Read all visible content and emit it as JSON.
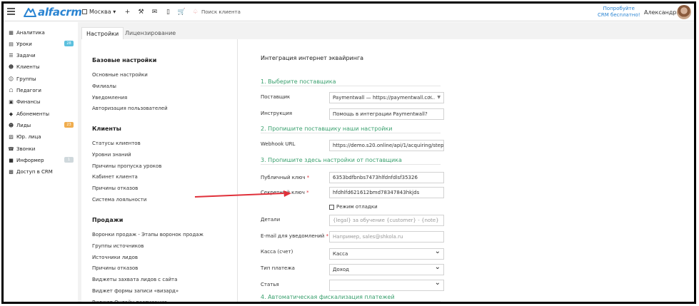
{
  "topbar": {
    "logo_text": "alfacrm",
    "city": "Москва",
    "search_placeholder": "Поиск клиента",
    "promo_line1": "Попробуйте",
    "promo_line2": "CRM бесплатно!",
    "user_name": "Александра"
  },
  "sidebar": {
    "items": [
      {
        "label": "Аналитика",
        "icon": "analytics-icon"
      },
      {
        "label": "Уроки",
        "icon": "calendar-icon",
        "badge": "28",
        "badge_color": "#5bc0de"
      },
      {
        "label": "Задачи",
        "icon": "tasks-icon"
      },
      {
        "label": "Клиенты",
        "icon": "user-icon"
      },
      {
        "label": "Группы",
        "icon": "users-icon"
      },
      {
        "label": "Педагоги",
        "icon": "graduation-icon"
      },
      {
        "label": "Финансы",
        "icon": "money-icon"
      },
      {
        "label": "Абонементы",
        "icon": "tag-icon"
      },
      {
        "label": "Лиды",
        "icon": "user-plus-icon",
        "badge": "23",
        "badge_color": "#f0ad4e"
      },
      {
        "label": "Юр. лица",
        "icon": "building-icon"
      },
      {
        "label": "Звонки",
        "icon": "phone-icon"
      },
      {
        "label": "Информер",
        "icon": "informer-icon",
        "badge": "1",
        "badge_color": "#cfd8dc"
      },
      {
        "label": "Доступ в CRM",
        "icon": "lock-icon"
      }
    ]
  },
  "tabs": [
    "Настройки",
    "Лицензирование"
  ],
  "settings": {
    "groups": [
      {
        "title": "Базовые настройки",
        "links": [
          "Основные настройки",
          "Филиалы",
          "Уведомления",
          "Авторизация пользователей"
        ]
      },
      {
        "title": "Клиенты",
        "links": [
          "Статусы клиентов",
          "Уровни знаний",
          "Причины пропуска уроков",
          "Кабинет клиента",
          "Причины отказов",
          "Система лояльности"
        ]
      },
      {
        "title": "Продажи",
        "links": [
          "Воронки продаж - Этапы воронок продаж",
          "Группы источников",
          "Источники лидов",
          "Причины отказов",
          "Виджеты захвата лидов с сайта",
          "Виджет формы записи «визард»",
          "Виджет Онлайн-расписание"
        ]
      }
    ]
  },
  "form": {
    "title": "Интеграция интернет эквайринга",
    "section1": "1. Выберите поставщика",
    "section2": "2. Пропишите поставщику наши настройки",
    "section3": "3. Пропишите здесь настройки от поставщика",
    "section4": "4. Автоматическая фискализация платежей",
    "provider_label": "Поставщик",
    "provider_value": "Paymentwall — https://paymentwall.co...",
    "instruction_label": "Инструкция",
    "instruction_value": "Помощь в интеграции Paymentwall?",
    "webhook_label": "Webhook URL",
    "webhook_value": "https://demo.s20.online/api/1/acquiring/step-tw",
    "public_key_label": "Публичный ключ",
    "public_key_value": "6353bdfbnbs7473hlfdnfdlsf35326",
    "secret_key_label": "Секретный ключ",
    "secret_key_value": "hfdhlfd621612bmd78347843hkjds",
    "debug_label": "Режим отладки",
    "details_label": "Детали",
    "details_placeholder": "{legal} за обучение {customer} - {note}",
    "email_label": "E-mail для уведомлений",
    "email_placeholder": "Например, sales@shkola.ru",
    "cash_label": "Касса (счет)",
    "cash_value": "Касса",
    "payment_type_label": "Тип платежа",
    "payment_type_value": "Доход",
    "article_label": "Статья",
    "article_value": "",
    "required_mark": "*"
  },
  "colors": {
    "brand": "#2a84d2",
    "section": "#3aa06e",
    "arrow": "#e0303a"
  }
}
